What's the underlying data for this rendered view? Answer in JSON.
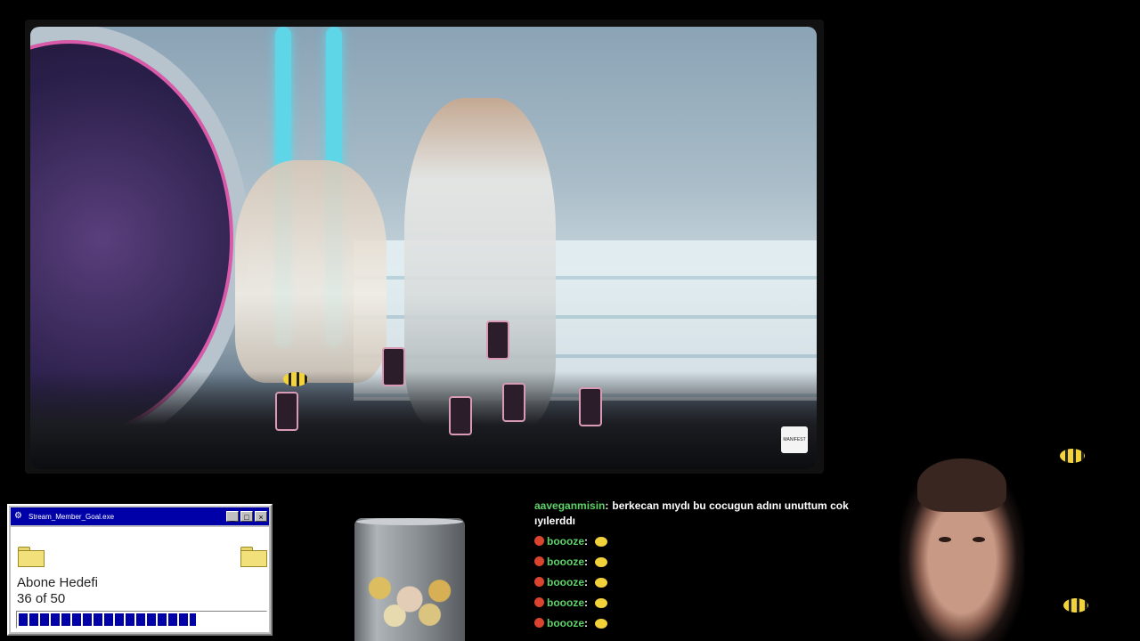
{
  "window": {
    "title": "Stream_Member_Goal.exe",
    "minimize_label": "_",
    "maximize_label": "□",
    "close_label": "×",
    "goal_label": "Abone Hedefi",
    "goal_count_text": "36 of 50",
    "progress": {
      "current": 36,
      "target": 50
    }
  },
  "video": {
    "watermark": "MANIFEST"
  },
  "chat": {
    "messages": [
      {
        "user": "aaveganmisin",
        "text": "berkecan mıydı bu cocugun adını unuttum cok ıyılerddı"
      },
      {
        "user": "boooze",
        "text": ""
      },
      {
        "user": "boooze",
        "text": ""
      },
      {
        "user": "boooze",
        "text": ""
      },
      {
        "user": "boooze",
        "text": ""
      },
      {
        "user": "boooze",
        "text": ""
      }
    ],
    "separator": ":"
  },
  "colors": {
    "titlebar": "#0000a8",
    "chat_username": "#5fd36a",
    "accent_pink": "#d95aa8",
    "pillar_cyan": "#5fd6e8"
  }
}
